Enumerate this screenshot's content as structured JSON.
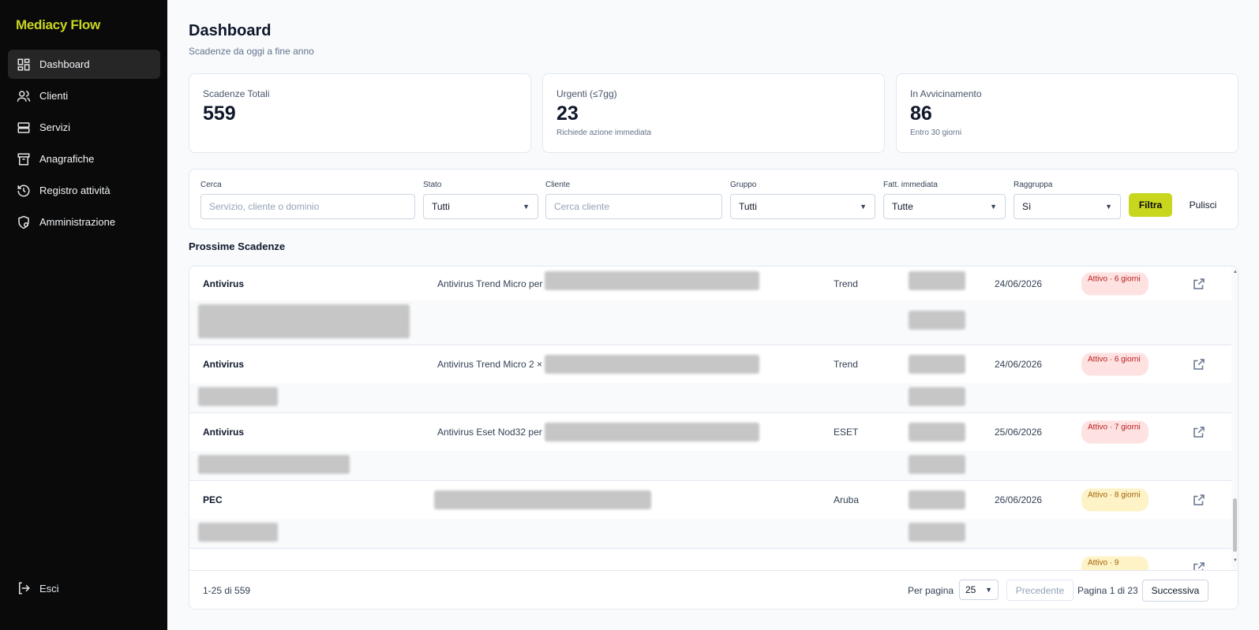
{
  "app": {
    "brand": "Mediacy Flow"
  },
  "colors": {
    "accent": "#c8d61e",
    "sidebar_bg": "#0a0a0a",
    "badge_red": "#fee2e2",
    "badge_yellow": "#fef3c7"
  },
  "sidebar": {
    "items": [
      {
        "label": "Dashboard",
        "icon": "dashboard-icon",
        "active": true
      },
      {
        "label": "Clienti",
        "icon": "users-icon"
      },
      {
        "label": "Servizi",
        "icon": "server-icon"
      },
      {
        "label": "Anagrafiche",
        "icon": "archive-icon"
      },
      {
        "label": "Registro attività",
        "icon": "history-icon"
      },
      {
        "label": "Amministrazione",
        "icon": "shield-gear-icon"
      }
    ],
    "logout": "Esci"
  },
  "header": {
    "title": "Dashboard",
    "subtitle": "Scadenze da oggi a fine anno"
  },
  "stats": [
    {
      "label": "Scadenze Totali",
      "value": "559",
      "note": ""
    },
    {
      "label": "Urgenti (≤7gg)",
      "value": "23",
      "note": "Richiede azione immediata"
    },
    {
      "label": "In Avvicinamento",
      "value": "86",
      "note": "Entro 30 giorni"
    }
  ],
  "filters": {
    "search": {
      "label": "Cerca",
      "placeholder": "Servizio, cliente o dominio"
    },
    "stato": {
      "label": "Stato",
      "value": "Tutti"
    },
    "cliente": {
      "label": "Cliente",
      "placeholder": "Cerca cliente"
    },
    "gruppo": {
      "label": "Gruppo",
      "value": "Tutti"
    },
    "fatt": {
      "label": "Fatt. immediata",
      "value": "Tutte"
    },
    "raggruppa": {
      "label": "Raggruppa",
      "value": "Sì"
    },
    "filter_button": "Filtra",
    "clear_button": "Pulisci"
  },
  "table": {
    "title": "Prossime Scadenze",
    "rows": [
      {
        "type": "Antivirus",
        "desc": "Antivirus Trend Micro per",
        "brand": "Trend",
        "date": "24/06/2026",
        "badge": "Attivo · 6 giorni",
        "level": "red"
      },
      {
        "type": "Antivirus",
        "desc": "Antivirus Trend Micro 2 ×",
        "brand": "Trend",
        "date": "24/06/2026",
        "badge": "Attivo · 6 giorni",
        "level": "red"
      },
      {
        "type": "Antivirus",
        "desc": "Antivirus Eset Nod32 per",
        "brand": "ESET",
        "date": "25/06/2026",
        "badge": "Attivo · 7 giorni",
        "level": "red"
      },
      {
        "type": "PEC",
        "desc": "",
        "brand": "Aruba",
        "date": "26/06/2026",
        "badge": "Attivo · 8 giorni",
        "level": "yellow"
      },
      {
        "type": "",
        "desc": "",
        "brand": "",
        "date": "",
        "badge": "Attivo · 9",
        "level": "yellow"
      }
    ]
  },
  "pagination": {
    "range": "1-25 di 559",
    "per_page_label": "Per pagina",
    "per_page_value": "25",
    "prev": "Precedente",
    "page_info": "Pagina 1 di 23",
    "next": "Successiva"
  }
}
